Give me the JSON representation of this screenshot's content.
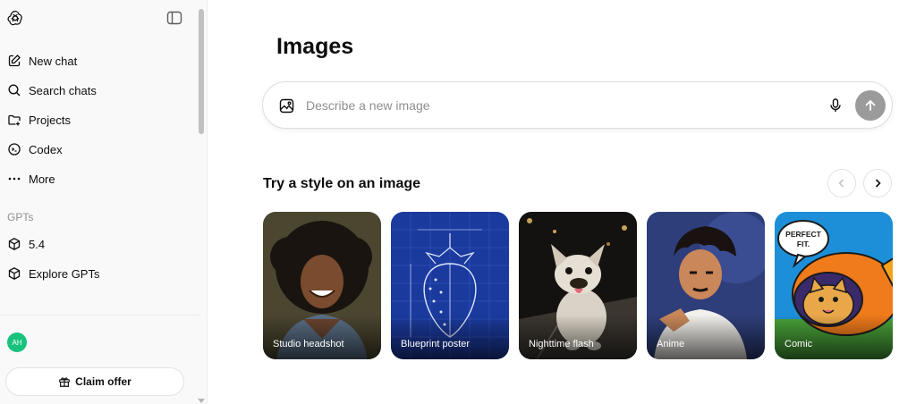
{
  "sidebar": {
    "nav": [
      {
        "label": "New chat",
        "icon": "edit-icon"
      },
      {
        "label": "Search chats",
        "icon": "search-icon"
      },
      {
        "label": "Projects",
        "icon": "folder-icon"
      },
      {
        "label": "Codex",
        "icon": "codex-icon"
      },
      {
        "label": "More",
        "icon": "more-icon"
      }
    ],
    "gpts_label": "GPTs",
    "gpts": [
      {
        "label": "5.4",
        "icon": "cube-icon"
      },
      {
        "label": "Explore GPTs",
        "icon": "cube-icon"
      }
    ],
    "avatar_initials": "AH",
    "claim_label": "Claim offer"
  },
  "main": {
    "title": "Images",
    "prompt_placeholder": "Describe a new image",
    "styles_title": "Try a style on an image",
    "styles": [
      {
        "label": "Studio headshot"
      },
      {
        "label": "Blueprint poster"
      },
      {
        "label": "Nighttime flash"
      },
      {
        "label": "Anime"
      },
      {
        "label": "Comic",
        "bubble_line1": "PERFECT",
        "bubble_line2": "FIT."
      }
    ]
  },
  "colors": {
    "sidebar_bg": "#f9f9f9",
    "avatar_bg": "#19c37d",
    "send_button": "#9b9b9b"
  }
}
